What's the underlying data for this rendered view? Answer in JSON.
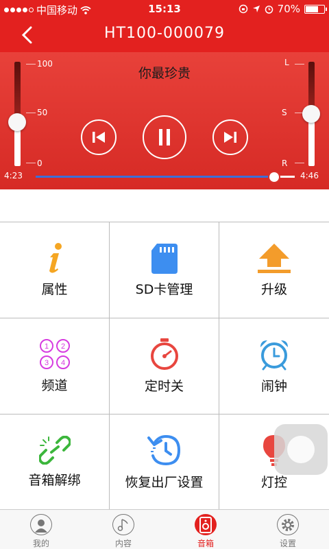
{
  "status_bar": {
    "carrier": "中国移动",
    "time": "15:13",
    "battery": "70%",
    "battery_level": 0.7,
    "signal_bars_filled": 4
  },
  "nav": {
    "back_icon": "chevron-left-icon",
    "title": "HT100-000079"
  },
  "player": {
    "song_title": "你最珍贵",
    "volume_scale": [
      "100",
      "50",
      "0"
    ],
    "volume_level": 0.42,
    "balance_scale": [
      "L",
      "S",
      "R"
    ],
    "balance_level": 0.5,
    "elapsed": "4:23",
    "total": "4:46",
    "progress": 0.92,
    "controls": [
      "previous-icon",
      "pause-icon",
      "next-icon"
    ]
  },
  "grid": {
    "items": [
      {
        "label": "属性",
        "icon": "info-icon",
        "color": "#f5a623"
      },
      {
        "label": "SD卡管理",
        "icon": "sd-card-icon",
        "color": "#3d8ef0"
      },
      {
        "label": "升级",
        "icon": "upgrade-icon",
        "color": "#f39c2b"
      },
      {
        "label": "频道",
        "icon": "channels-icon",
        "color": "#d63ce0"
      },
      {
        "label": "定时关",
        "icon": "timer-icon",
        "color": "#e8463f"
      },
      {
        "label": "闹钟",
        "icon": "alarm-clock-icon",
        "color": "#3a9bdc"
      },
      {
        "label": "音箱解绑",
        "icon": "unlink-icon",
        "color": "#3cb63c"
      },
      {
        "label": "恢复出厂设置",
        "icon": "restore-icon",
        "color": "#3d8ef0"
      },
      {
        "label": "灯控",
        "icon": "light-bulb-icon",
        "color": "#e8463f"
      }
    ]
  },
  "tabs": [
    {
      "label": "我的",
      "icon": "profile-icon",
      "active": false
    },
    {
      "label": "内容",
      "icon": "music-note-icon",
      "active": false
    },
    {
      "label": "音箱",
      "icon": "speaker-icon",
      "active": true
    },
    {
      "label": "设置",
      "icon": "gear-icon",
      "active": false
    }
  ],
  "colors": {
    "accent": "#e3211f",
    "progress": "#3c6fd9"
  }
}
